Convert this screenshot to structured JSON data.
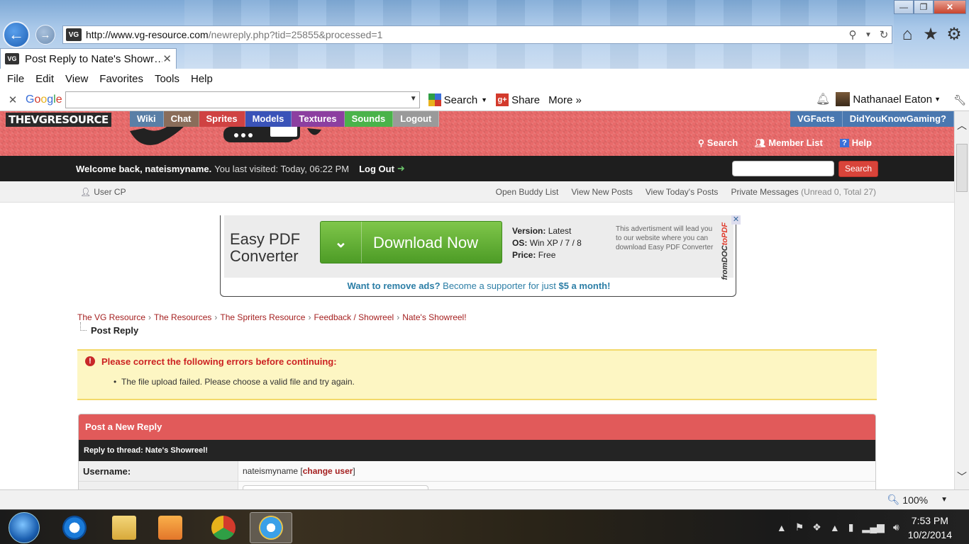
{
  "browser": {
    "url_prefix": "http://www.vg-resource.com",
    "url_rest": "/newreply.php?tid=25855&processed=1",
    "tab_title": "Post Reply to Nate's Showr…",
    "favicon": "VG",
    "menu": [
      "File",
      "Edit",
      "View",
      "Favorites",
      "Tools",
      "Help"
    ],
    "toolbar": {
      "google": [
        "G",
        "o",
        "o",
        "g",
        "l",
        "e"
      ],
      "search_label": "Search",
      "share_label": "Share",
      "more_label": "More »",
      "user_name": "Nathanael Eaton"
    },
    "zoom": "100%"
  },
  "site": {
    "logo": "THEVGRESOURCE",
    "nav": [
      {
        "label": "Wiki",
        "color": "#5a7fa6"
      },
      {
        "label": "Chat",
        "color": "#8a6d5a"
      },
      {
        "label": "Sprites",
        "color": "#cf4242"
      },
      {
        "label": "Models",
        "color": "#3a53b8"
      },
      {
        "label": "Textures",
        "color": "#8c3fa0"
      },
      {
        "label": "Sounds",
        "color": "#4ab34a"
      },
      {
        "label": "Logout",
        "color": "#9a9a9a"
      }
    ],
    "nav_right": [
      {
        "label": "VGFacts",
        "color": "#4a78b0"
      },
      {
        "label": "DidYouKnowGaming?",
        "color": "#4a78b0"
      }
    ],
    "header_links": {
      "search": "Search",
      "members": "Member List",
      "help": "Help"
    },
    "welcome": {
      "greeting": "Welcome back, nateismyname.",
      "visited": "You last visited: Today, 06:22 PM",
      "logout": "Log Out",
      "search_button": "Search"
    },
    "usercp": {
      "label": "User CP",
      "links": [
        "Open Buddy List",
        "View New Posts",
        "View Today's Posts",
        "Private Messages"
      ],
      "pm_counts": "(Unread 0, Total 27)"
    }
  },
  "ad": {
    "title_line1": "Easy PDF",
    "title_line2": "Converter",
    "download_label": "Download Now",
    "version_label": "Version:",
    "version_value": "Latest",
    "os_label": "OS:",
    "os_value": "Win XP / 7 / 8",
    "price_label": "Price:",
    "price_value": "Free",
    "note": "This advertisment will lead you to our website where you can download Easy PDF Converter",
    "brand_a": "fromDOC",
    "brand_b": "to",
    "brand_c": "PDF",
    "close": "✕",
    "supporter_a": "Want to remove ads?",
    "supporter_b": "Become a supporter for just",
    "supporter_c": "$5 a month!"
  },
  "breadcrumb": {
    "items": [
      "The VG Resource",
      "The Resources",
      "The Spriters Resource",
      "Feedback / Showreel",
      "Nate's Showreel!"
    ],
    "current": "Post Reply"
  },
  "error": {
    "title": "Please correct the following errors before continuing:",
    "message": "The file upload failed. Please choose a valid file and try again."
  },
  "form": {
    "heading": "Post a New Reply",
    "subheading": "Reply to thread: Nate's Showreel!",
    "username_label": "Username:",
    "username_value": "nateismyname",
    "change_user": "change user"
  },
  "taskbar": {
    "time": "7:53 PM",
    "date": "10/2/2014"
  }
}
